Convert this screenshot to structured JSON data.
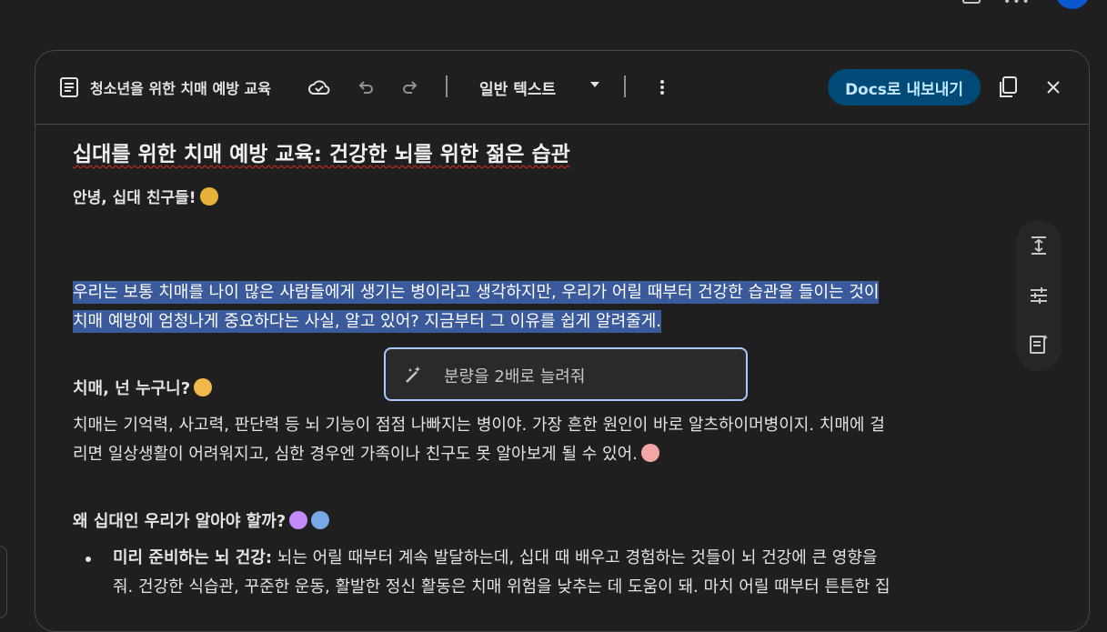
{
  "header": {
    "doc_title": "청소년을 위한 치매 예방 교육",
    "style_label": "일반 텍스트",
    "export_label": "Docs로 내보내기",
    "icons": [
      "document-icon",
      "cloud-icon",
      "undo-icon",
      "redo-icon",
      "more-vert-icon",
      "copy-icon",
      "close-icon"
    ]
  },
  "document": {
    "title": "십대를 위한 치매 예방 교육: 건강한 뇌를 위한 젊은 습관",
    "greeting": "안녕, 십대 친구들!",
    "intro_line1": "우리는 보통 치매를 나이 많은 사람들에게 생기는 병이라고 생각하지만, 우리가 어릴 때부터 건강한 습관을 들이는 것이",
    "intro_line2": "치매 예방에 엄청나게 중요하다는 사실, 알고 있어? 지금부터 그 이유를 쉽게 알려줄게.",
    "section1_title": "치매, 넌 누구니?",
    "section1_line1": "치매는 기억력, 사고력, 판단력 등 뇌 기능이 점점 나빠지는 병이야. 가장 흔한 원인이 바로 알츠하이머병이지. 치매에 걸",
    "section1_line2": "리면 일상생활이 어려워지고, 심한 경우엔 가족이나 친구도 못 알아보게 될 수 있어.",
    "section2_title": "왜 십대인 우리가 알아야 할까?",
    "bullet1_bold": "미리 준비하는 뇌 건강:",
    "bullet1_text": " 뇌는 어릴 때부터 계속 발달하는데, 십대 때 배우고 경험하는 것들이 뇌 건강에 큰 영향을",
    "bullet1_line2": "줘. 건강한 식습관, 꾸준한 운동, 활발한 정신 활동은 치매 위험을 낮추는 데 도움이 돼. 마치 어릴 때부터 튼튼한 집"
  },
  "suggestion": {
    "text": "분량을 2배로 늘려줘"
  },
  "side_tools": [
    "expand-vertical-icon",
    "tune-icon",
    "summarize-icon"
  ],
  "colors": {
    "selection": "#3a5a9c",
    "export_bg": "#004a77",
    "export_fg": "#c2e7ff",
    "suggest_border": "#a8c7fa"
  }
}
